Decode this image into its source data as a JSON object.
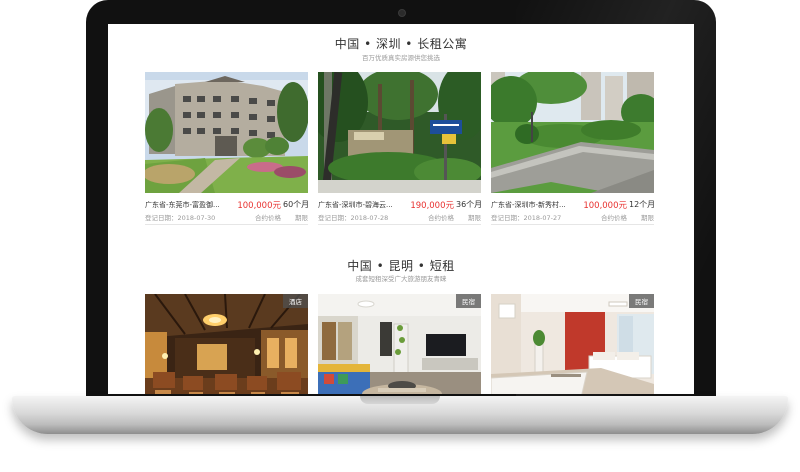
{
  "sections": [
    {
      "title": "中国 • 深圳 • 长租公寓",
      "subtitle": "百万优质真实房源供您挑选",
      "cards": [
        {
          "address": "广东省-东莞市-富盈御...",
          "price": "100,000元",
          "price_label": "合约价格",
          "term": "60个月",
          "term_label": "期限",
          "date": "登记日期：2018-07-30"
        },
        {
          "address": "广东省-深圳市-碧海云...",
          "price": "190,000元",
          "price_label": "合约价格",
          "term": "36个月",
          "term_label": "期限",
          "date": "登记日期：2018-07-28"
        },
        {
          "address": "广东省-深圳市-新秀村...",
          "price": "100,000元",
          "price_label": "合约价格",
          "term": "12个月",
          "term_label": "期限",
          "date": "登记日期：2018-07-27"
        }
      ]
    },
    {
      "title": "中国 • 昆明 • 短租",
      "subtitle": "成套短租深受广大旅游朋友青睐",
      "cards": [
        {
          "tag": "酒店"
        },
        {
          "tag": "民宿"
        },
        {
          "tag": "民宿"
        }
      ]
    }
  ],
  "colors": {
    "price": "#e8312f",
    "title": "#333333",
    "muted": "#999999",
    "laptop_bezel": "#111111"
  }
}
